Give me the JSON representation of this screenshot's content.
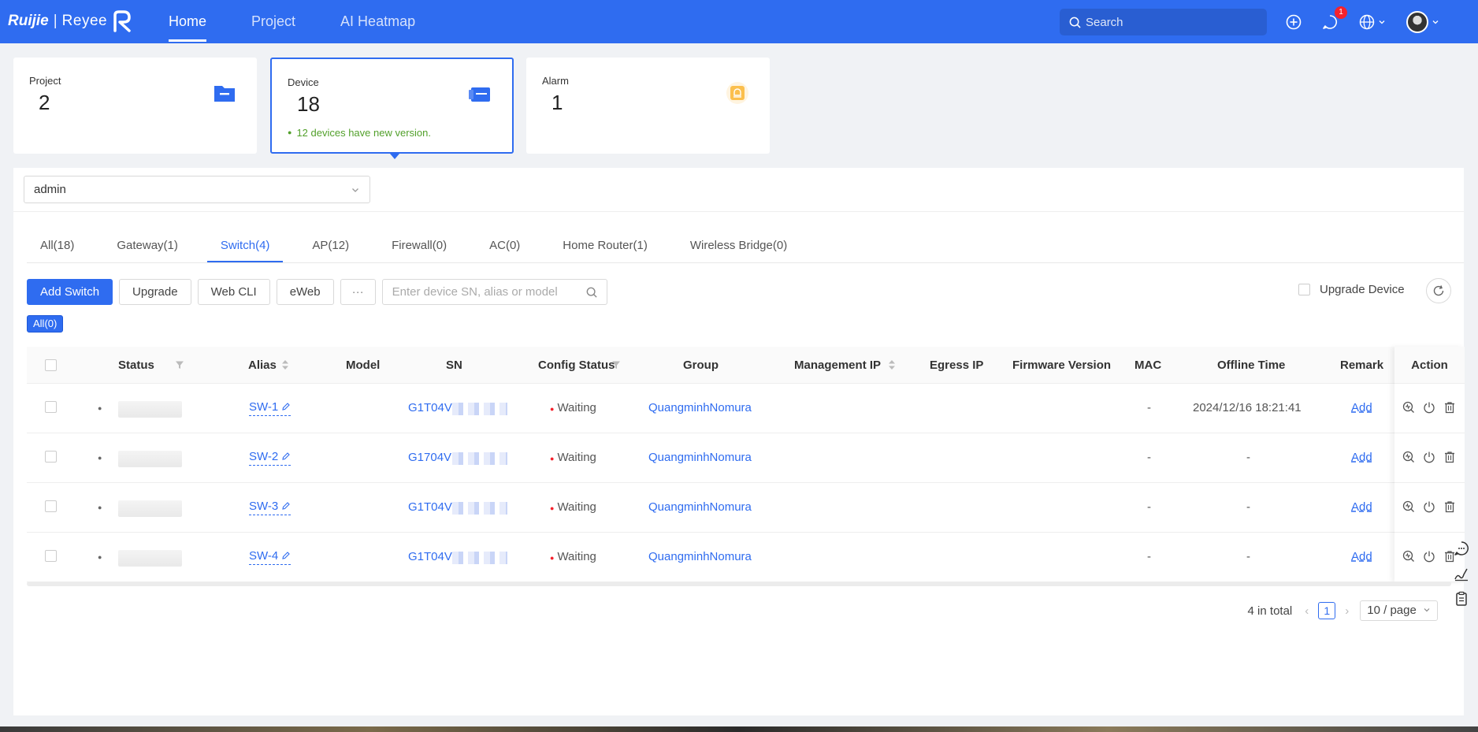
{
  "header": {
    "logo_brand": "Ruijie",
    "logo_sep": "|",
    "logo_product": "Reyee",
    "nav": [
      "Home",
      "Project",
      "AI Heatmap"
    ],
    "search_placeholder": "Search",
    "message_badge": "1"
  },
  "cards": {
    "project": {
      "label": "Project",
      "value": "2"
    },
    "device": {
      "label": "Device",
      "value": "18",
      "note": "12 devices have new version."
    },
    "alarm": {
      "label": "Alarm",
      "value": "1"
    }
  },
  "tenant_select": "admin",
  "tabs": [
    "All(18)",
    "Gateway(1)",
    "Switch(4)",
    "AP(12)",
    "Firewall(0)",
    "AC(0)",
    "Home Router(1)",
    "Wireless Bridge(0)"
  ],
  "toolbar": {
    "add": "Add Switch",
    "upgrade": "Upgrade",
    "webcli": "Web CLI",
    "eweb": "eWeb",
    "more": "···",
    "search_placeholder": "Enter device SN, alias or model",
    "upgrade_device": "Upgrade Device"
  },
  "filter_tag": "All(0)",
  "table": {
    "headers": {
      "status": "Status",
      "alias": "Alias",
      "model": "Model",
      "sn": "SN",
      "config": "Config Status",
      "group": "Group",
      "mgmt_ip": "Management IP",
      "egress": "Egress IP",
      "firmware": "Firmware Version",
      "mac": "MAC",
      "offline": "Offline Time",
      "remark": "Remark",
      "action": "Action"
    },
    "rows": [
      {
        "alias": "SW-1",
        "sn": "G1T04V",
        "config": "Waiting",
        "group": "QuangminhNomura",
        "mac": "-",
        "offline": "2024/12/16 18:21:41",
        "remark": "Add"
      },
      {
        "alias": "SW-2",
        "sn": "G1704V",
        "config": "Waiting",
        "group": "QuangminhNomura",
        "mac": "-",
        "offline": "-",
        "remark": "Add"
      },
      {
        "alias": "SW-3",
        "sn": "G1T04V",
        "config": "Waiting",
        "group": "QuangminhNomura",
        "mac": "-",
        "offline": "-",
        "remark": "Add"
      },
      {
        "alias": "SW-4",
        "sn": "G1T04V",
        "config": "Waiting",
        "group": "QuangminhNomura",
        "mac": "-",
        "offline": "-",
        "remark": "Add"
      }
    ]
  },
  "pager": {
    "total": "4 in total",
    "page": "1",
    "size": "10 / page"
  },
  "colors": {
    "brand": "#2f6cf0",
    "success": "#52a02b",
    "danger": "#f5222d"
  }
}
